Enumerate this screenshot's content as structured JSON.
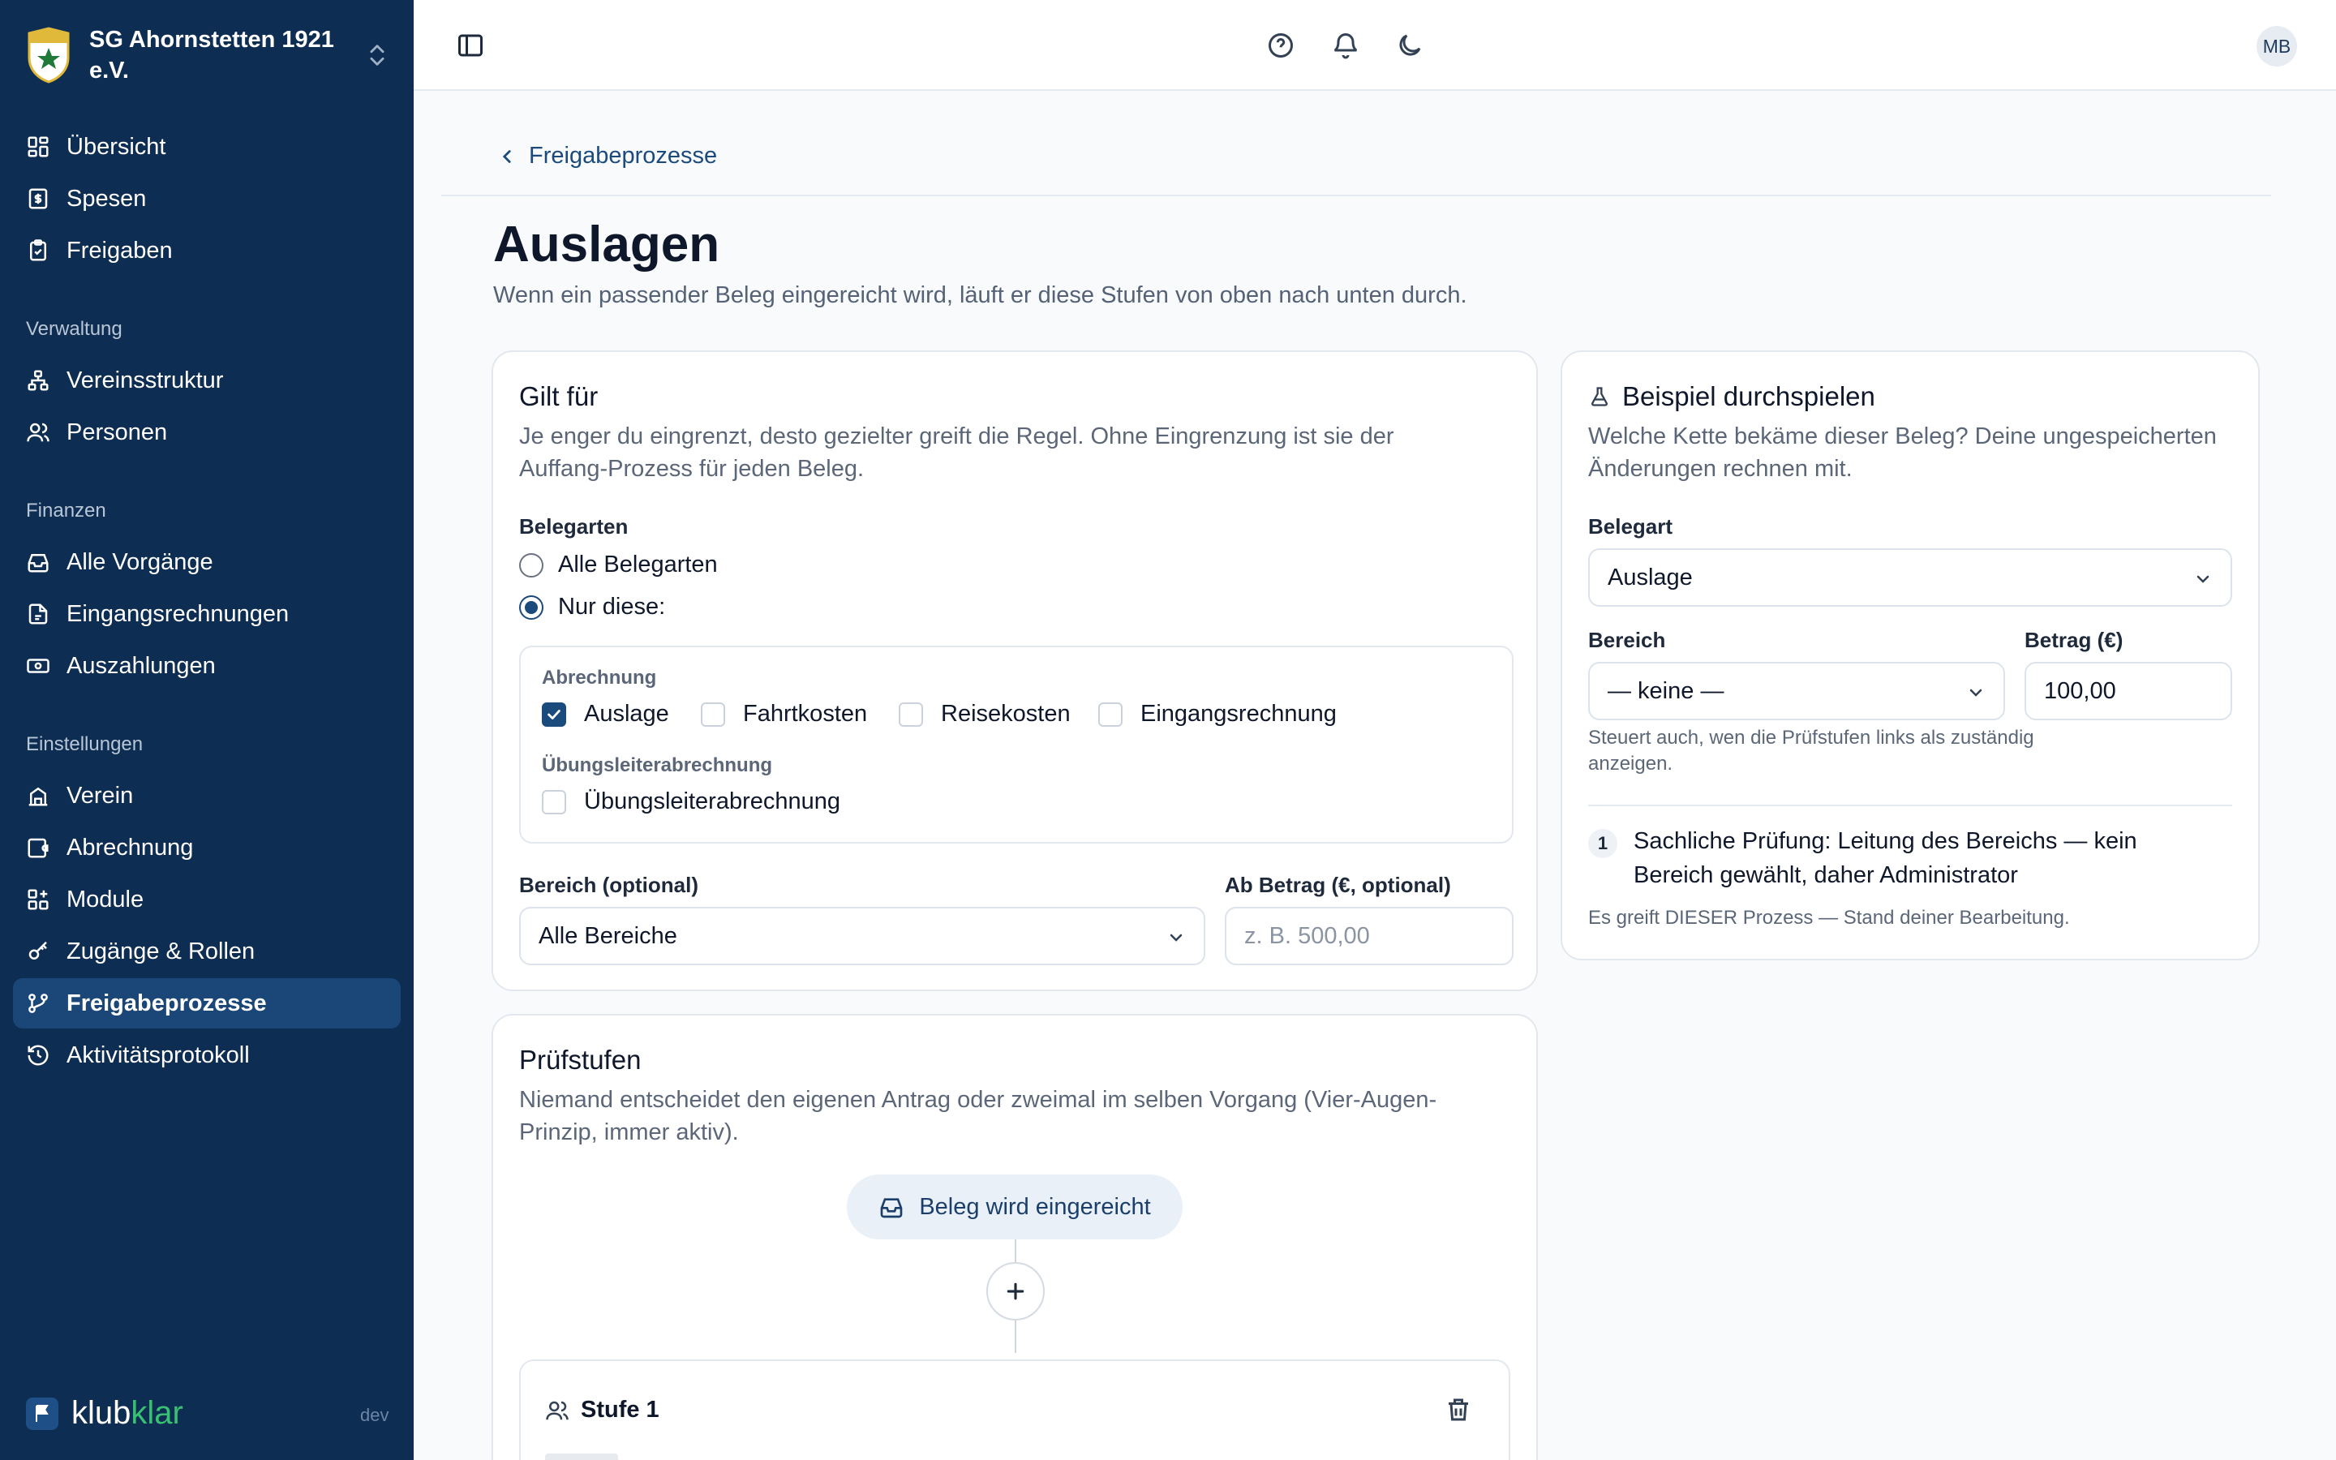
{
  "club": {
    "name": "SG Ahornstetten 1921 e.V."
  },
  "nav": {
    "main": [
      {
        "label": "Übersicht",
        "icon": "dashboard-icon"
      },
      {
        "label": "Spesen",
        "icon": "receipt-icon"
      },
      {
        "label": "Freigaben",
        "icon": "clipboard-check-icon"
      }
    ],
    "sections": {
      "verwaltung": "Verwaltung",
      "finanzen": "Finanzen",
      "einstellungen": "Einstellungen"
    },
    "verwaltung": [
      {
        "label": "Vereinsstruktur",
        "icon": "network-icon"
      },
      {
        "label": "Personen",
        "icon": "users-icon"
      }
    ],
    "finanzen": [
      {
        "label": "Alle Vorgänge",
        "icon": "inbox-icon"
      },
      {
        "label": "Eingangsrechnungen",
        "icon": "file-icon"
      },
      {
        "label": "Auszahlungen",
        "icon": "banknote-icon"
      }
    ],
    "einstellungen": [
      {
        "label": "Verein",
        "icon": "building-icon"
      },
      {
        "label": "Abrechnung",
        "icon": "wallet-icon"
      },
      {
        "label": "Module",
        "icon": "modules-icon"
      },
      {
        "label": "Zugänge & Rollen",
        "icon": "key-icon"
      },
      {
        "label": "Freigabeprozesse",
        "icon": "workflow-icon",
        "active": true
      },
      {
        "label": "Aktivitätsprotokoll",
        "icon": "history-icon"
      }
    ]
  },
  "brand": {
    "part1": "klub",
    "part2": "klar",
    "env": "dev"
  },
  "topbar": {
    "avatar": "MB"
  },
  "breadcrumb": {
    "back_label": "Freigabeprozesse"
  },
  "page": {
    "title": "Auslagen",
    "subtitle": "Wenn ein passender Beleg eingereicht wird, läuft er diese Stufen von oben nach unten durch."
  },
  "scope": {
    "title": "Gilt für",
    "desc_line1": "Je enger du eingrenzt, desto gezielter greift die Regel. Ohne Eingrenzung ist sie der",
    "desc_line2": "Auffang-Prozess für jeden Beleg.",
    "belegarten_label": "Belegarten",
    "radio_all": "Alle Belegarten",
    "radio_only": "Nur diese:",
    "group1_label": "Abrechnung",
    "checkboxes": [
      {
        "label": "Auslage",
        "checked": true
      },
      {
        "label": "Fahrtkosten",
        "checked": false
      },
      {
        "label": "Reisekosten",
        "checked": false
      },
      {
        "label": "Eingangsrechnung",
        "checked": false
      }
    ],
    "group2_label": "Übungsleiterabrechnung",
    "group2_checkbox": {
      "label": "Übungsleiterabrechnung",
      "checked": false
    },
    "bereich_label": "Bereich (optional)",
    "bereich_value": "Alle Bereiche",
    "betrag_label": "Ab Betrag (€, optional)",
    "betrag_placeholder": "z. B. 500,00"
  },
  "stages": {
    "title": "Prüfstufen",
    "desc_line1": "Niemand entscheidet den eigenen Antrag oder zweimal im selben Vorgang (Vier-Augen-",
    "desc_line2": "Prinzip, immer aktiv).",
    "start_pill": "Beleg wird eingereicht",
    "stage1_title": "Stufe 1"
  },
  "simulate": {
    "title": "Beispiel durchspielen",
    "desc_line1": "Welche Kette bekäme dieser Beleg? Deine ungespeicherten",
    "desc_line2": "Änderungen rechnen mit.",
    "belegart_label": "Belegart",
    "belegart_value": "Auslage",
    "bereich_label": "Bereich",
    "bereich_value": "— keine —",
    "betrag_label": "Betrag (€)",
    "betrag_value": "100,00",
    "hint": "Steuert auch, wen die Prüfstufen links als zuständig anzeigen.",
    "result_step_num": "1",
    "result_step_text": "Sachliche Prüfung: Leitung des Bereichs — kein Bereich gewählt, daher Administrator",
    "footnote": "Es greift DIESER Prozess — Stand deiner Bearbeitung."
  },
  "colors": {
    "sidebar_bg": "#0d2d52",
    "sidebar_active": "#1a4778",
    "accent": "#1b4a7d",
    "brand_green": "#38c172"
  }
}
